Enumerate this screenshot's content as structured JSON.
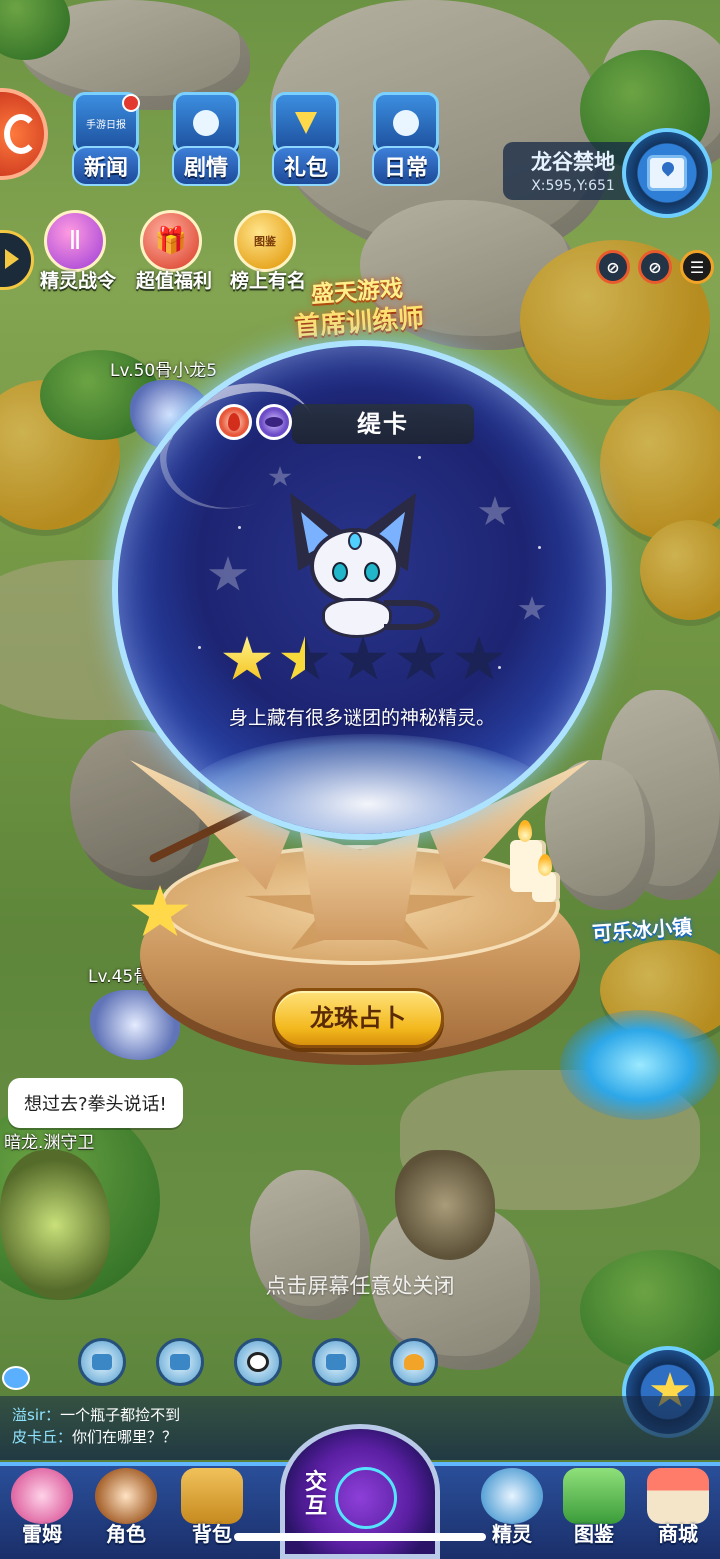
{
  "top_menu": {
    "news": "新闻",
    "story": "剧情",
    "gift": "礼包",
    "daily": "日常",
    "news_badge_text": "手游日报"
  },
  "second_row": {
    "pass": "精灵战令",
    "welfare": "超值福利",
    "ranking": "榜上有名",
    "ranking_badge": "图鉴"
  },
  "location": {
    "name": "龙谷禁地",
    "coords": "X:595,Y:651"
  },
  "event_banner": {
    "line1": "盛天游戏",
    "line2": "首席训练师"
  },
  "world": {
    "npc1_label": "Lv.50骨小龙5",
    "npc2_label": "Lv.45骨",
    "npc3_label": "暗龙.渊守卫",
    "town_label": "可乐冰小镇",
    "speech": "想过去?拳头说话!"
  },
  "dialog": {
    "pet_name": "缇卡",
    "rating": 1.5,
    "rating_max": 5,
    "description": "身上藏有很多谜团的神秘精灵。",
    "divine_button": "龙珠占卜",
    "close_hint": "点击屏幕任意处关闭",
    "attributes": [
      "fire-icon",
      "dark-icon"
    ]
  },
  "chat": {
    "messages": [
      {
        "who": "溢sir：",
        "text": "一个瓶子都捡不到"
      },
      {
        "who": "皮卡丘：",
        "text": "你们在哪里？？"
      }
    ]
  },
  "bottom_nav": {
    "leimu": "雷姆",
    "role": "角色",
    "bag": "背包",
    "interact": "交互",
    "spirit": "精灵",
    "dex": "图鉴",
    "shop": "商城"
  },
  "colors": {
    "accent_blue": "#1c4f9c",
    "button_gold": "#f3b81d",
    "star_gold": "#f3c118"
  }
}
